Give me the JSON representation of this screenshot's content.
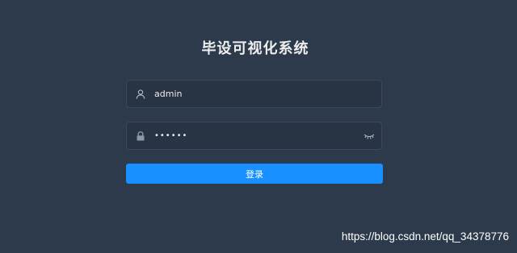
{
  "title": "毕设可视化系统",
  "username": {
    "value": "admin",
    "icon": "user-icon"
  },
  "password": {
    "value": "••••••",
    "icon": "lock-icon",
    "toggle_icon": "eye-closed-icon"
  },
  "login_button": {
    "label": "登录",
    "color": "#1890ff"
  },
  "watermark": "https://blog.csdn.net/qq_34378776",
  "colors": {
    "background": "#2d3a4b",
    "input_bg": "#283443"
  }
}
